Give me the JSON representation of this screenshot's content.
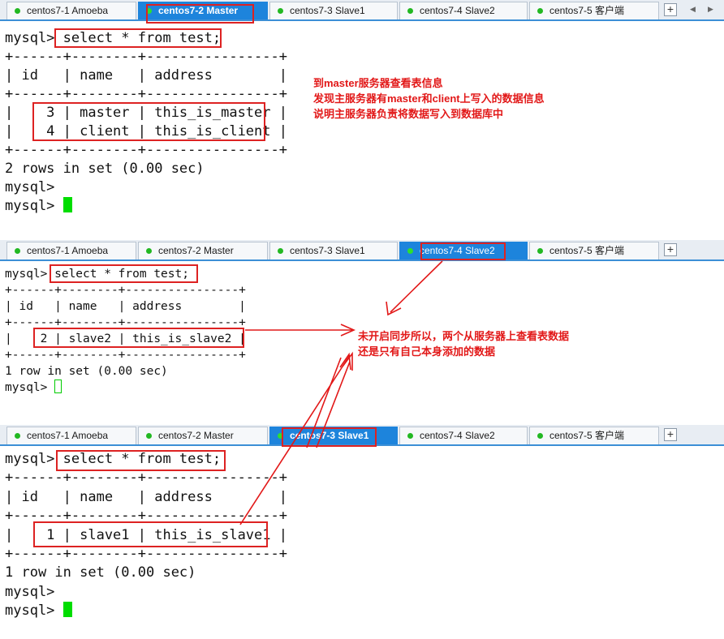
{
  "tabs": [
    "centos7-1 Amoeba",
    "centos7-2 Master",
    "centos7-3 Slave1",
    "centos7-4 Slave2",
    "centos7-5 客户端"
  ],
  "plus_label": "+",
  "arrow_left": "◀",
  "arrow_right": "▶",
  "cursor_color": "#00dd00",
  "annotation_color": "#e21818",
  "active_tab_color": "#1d84dc",
  "panel_master": {
    "active_tab": "centos7-2 Master",
    "lines": [
      "mysql> select * from test;",
      "+------+--------+----------------+",
      "| id   | name   | address        |",
      "+------+--------+----------------+",
      "|    3 | master | this_is_master |",
      "|    4 | client | this_is_client |",
      "+------+--------+----------------+",
      "2 rows in set (0.00 sec)",
      "",
      "mysql>",
      "mysql> "
    ]
  },
  "panel_slave2": {
    "active_tab": "centos7-4 Slave2",
    "lines": [
      "mysql> select * from test;",
      "+------+--------+----------------+",
      "| id   | name   | address        |",
      "+------+--------+----------------+",
      "|    2 | slave2 | this_is_slave2 |",
      "+------+--------+----------------+",
      "1 row in set (0.00 sec)",
      "",
      "mysql> "
    ]
  },
  "panel_slave1": {
    "active_tab": "centos7-3 Slave1",
    "lines": [
      "mysql> select * from test;",
      "+------+--------+----------------+",
      "| id   | name   | address        |",
      "+------+--------+----------------+",
      "|    1 | slave1 | this_is_slave1 |",
      "+------+--------+----------------+",
      "1 row in set (0.00 sec)",
      "",
      "mysql>",
      "mysql> "
    ]
  },
  "annotation_master": [
    "到master服务器查看表信息",
    "发现主服务器有master和client上写入的数据信息",
    "说明主服务器负责将数据写入到数据库中"
  ],
  "annotation_slaves": [
    "未开启同步所以，两个从服务器上查看表数据",
    "还是只有自己本身添加的数据"
  ]
}
